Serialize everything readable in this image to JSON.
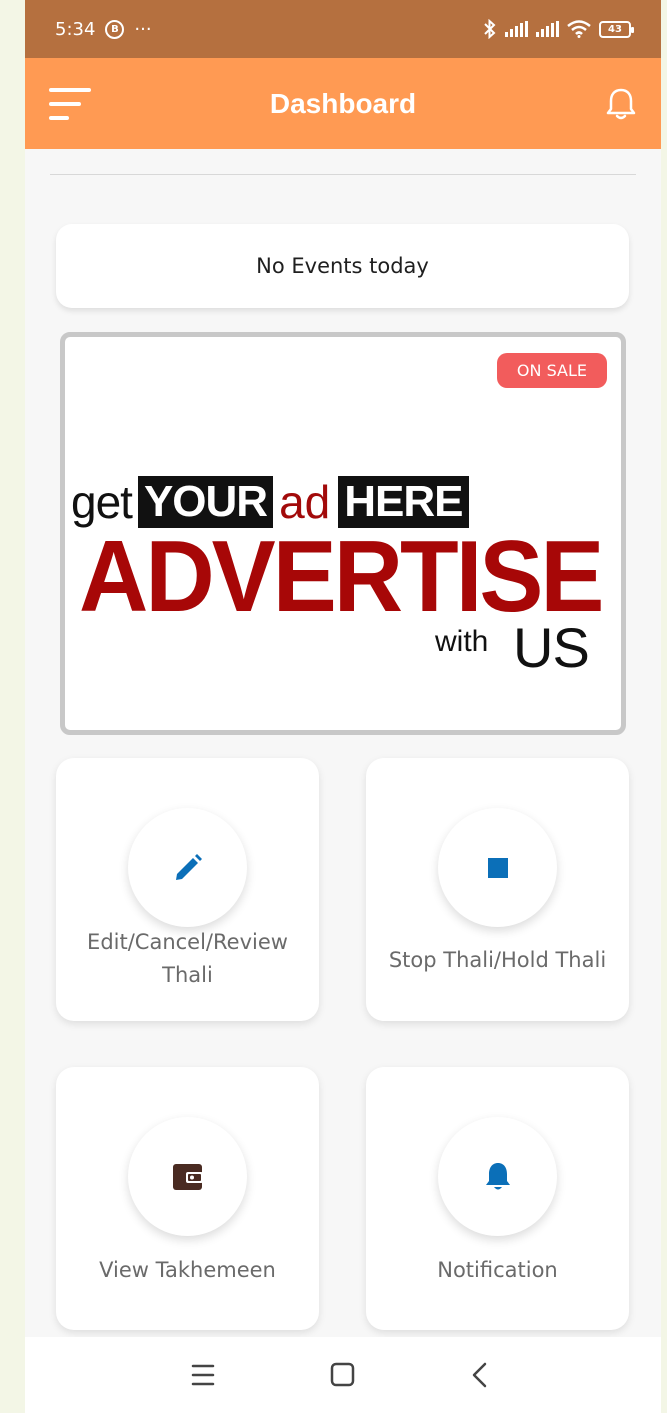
{
  "status_bar": {
    "time": "5:34",
    "b_badge": "B",
    "dots": "···",
    "battery": "43"
  },
  "app_bar": {
    "title": "Dashboard",
    "background": "#ff9a53"
  },
  "events": {
    "message": "No Events today"
  },
  "ad": {
    "badge": "ON SALE",
    "line_get": "get",
    "line_your": "YOUR",
    "line_ad": "ad",
    "line_here": "HERE",
    "headline": "ADVERTISE",
    "with": "with",
    "us": "US"
  },
  "tiles": [
    {
      "label": "Edit/Cancel/Review Thali",
      "icon": "pencil-icon",
      "icon_color": "#0b6fb8"
    },
    {
      "label": "Stop Thali/Hold Thali",
      "icon": "stop-icon",
      "icon_color": "#0b6fb8"
    },
    {
      "label": "View Takhemeen",
      "icon": "wallet-icon",
      "icon_color": "#4a2b22"
    },
    {
      "label": "Notification",
      "icon": "bell-icon",
      "icon_color": "#0b6fb8"
    }
  ],
  "nav": {
    "items": [
      "menu-nav-icon",
      "home-nav-icon",
      "back-nav-icon"
    ]
  }
}
